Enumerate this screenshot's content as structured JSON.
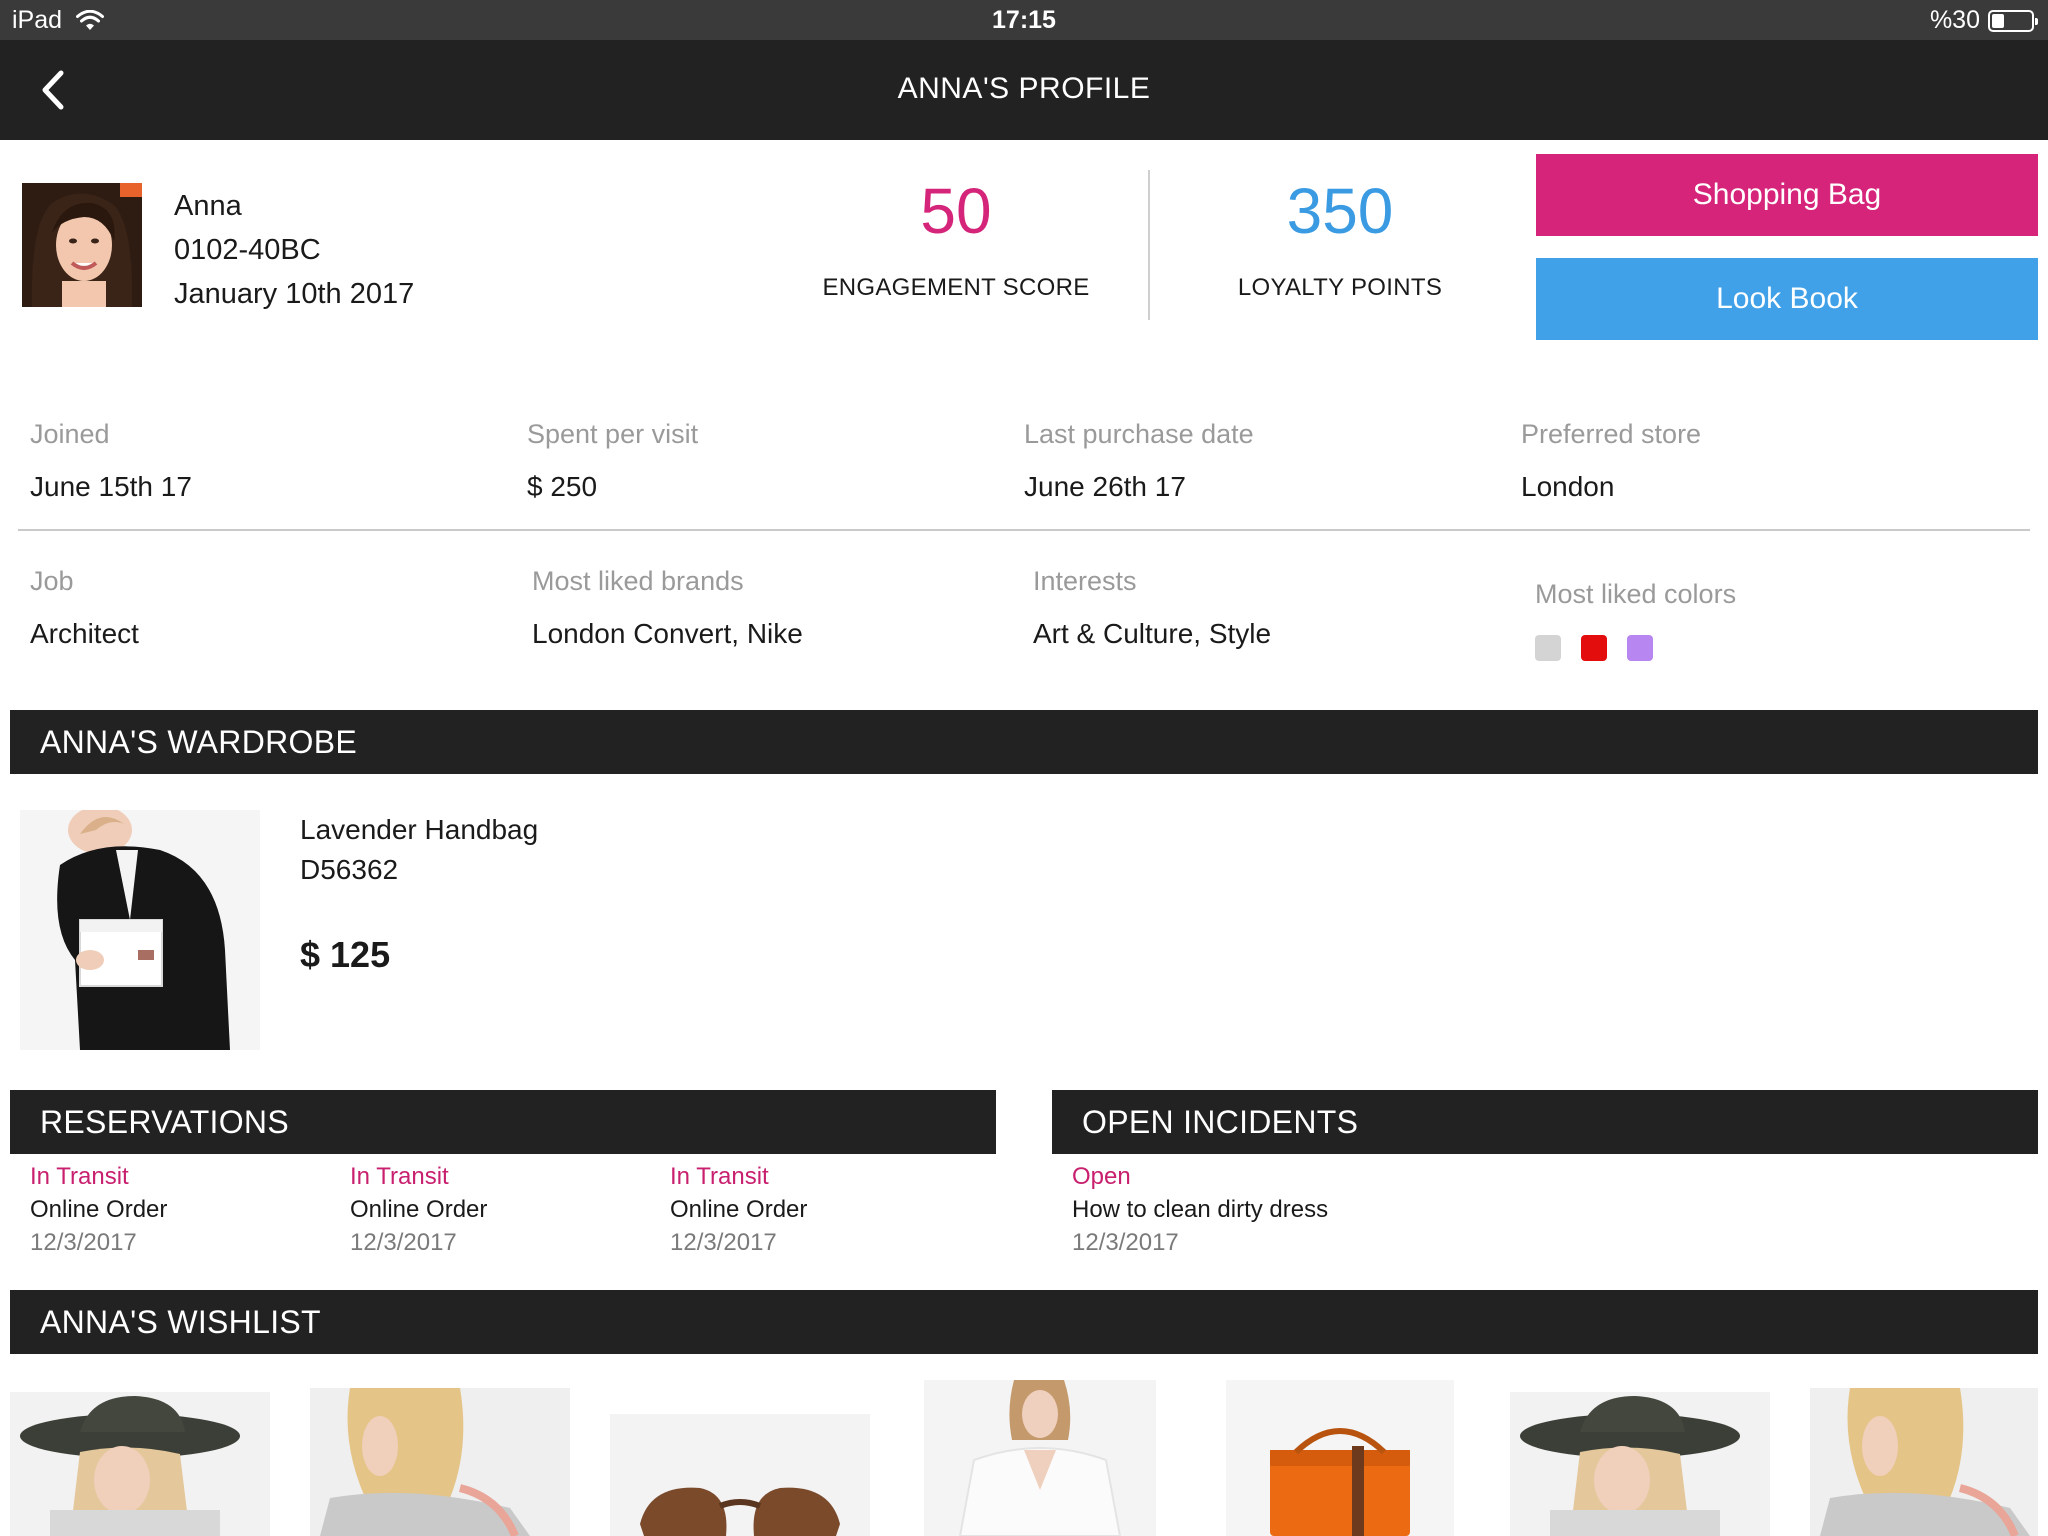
{
  "status_bar": {
    "device": "iPad",
    "time": "17:15",
    "battery": "%30"
  },
  "nav": {
    "title": "ANNA'S PROFILE"
  },
  "profile": {
    "name": "Anna",
    "id": "0102-40BC",
    "date": "January 10th 2017"
  },
  "stats": {
    "engagement_value": "50",
    "engagement_label": "ENGAGEMENT SCORE",
    "loyalty_value": "350",
    "loyalty_label": "LOYALTY POINTS"
  },
  "actions": {
    "shopping_bag": "Shopping Bag",
    "look_book": "Look Book"
  },
  "details": [
    {
      "label": "Joined",
      "value": "June 15th 17"
    },
    {
      "label": "Spent per visit",
      "value": "$ 250"
    },
    {
      "label": "Last purchase date",
      "value": "June 26th 17"
    },
    {
      "label": "Preferred store",
      "value": "London"
    },
    {
      "label": "Job",
      "value": "Architect"
    },
    {
      "label": "Most liked brands",
      "value": "London Convert, Nike"
    },
    {
      "label": "Interests",
      "value": "Art & Culture, Style"
    },
    {
      "label": "Most liked colors",
      "colors": [
        "#d4d4d4",
        "#e30d0d",
        "#b786f0"
      ]
    }
  ],
  "wardrobe": {
    "title": "ANNA'S WARDROBE",
    "item": {
      "name": "Lavender Handbag",
      "code": "D56362",
      "price": "$ 125"
    }
  },
  "reservations": {
    "title": "RESERVATIONS",
    "items": [
      {
        "status": "In Transit",
        "type": "Online Order",
        "date": "12/3/2017"
      },
      {
        "status": "In Transit",
        "type": "Online Order",
        "date": "12/3/2017"
      },
      {
        "status": "In Transit",
        "type": "Online Order",
        "date": "12/3/2017"
      }
    ]
  },
  "incidents": {
    "title": "OPEN INCIDENTS",
    "items": [
      {
        "status": "Open",
        "type": "How to clean dirty dress",
        "date": "12/3/2017"
      }
    ]
  },
  "wishlist": {
    "title": "ANNA'S WISHLIST"
  },
  "colors": {
    "accent_pink": "#d6247b",
    "accent_blue": "#41a1e8",
    "header_dark": "#222222"
  }
}
